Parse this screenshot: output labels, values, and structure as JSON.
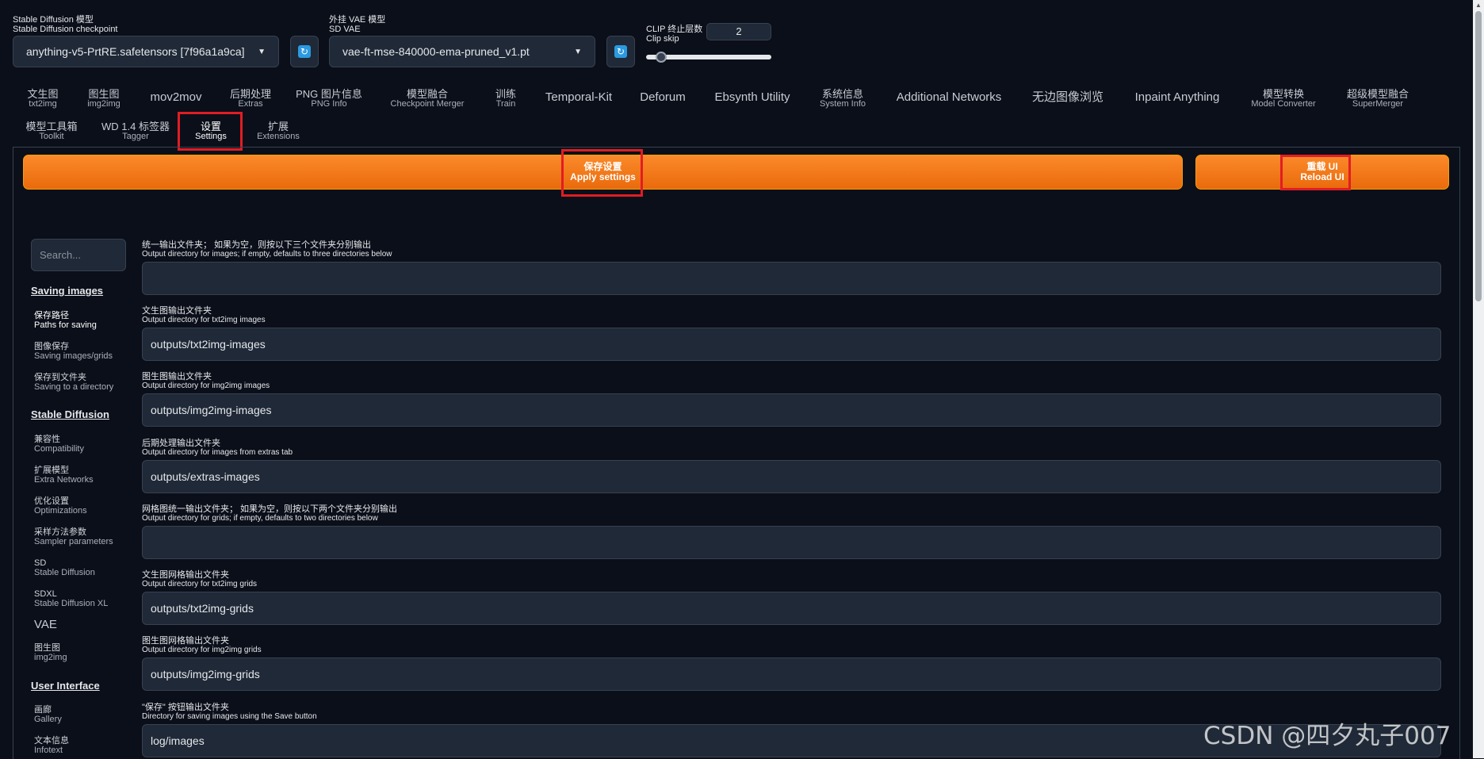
{
  "top": {
    "checkpoint": {
      "label_cn": "Stable Diffusion 模型",
      "label_en": "Stable Diffusion checkpoint",
      "value": "anything-v5-PrtRE.safetensors [7f96a1a9ca]"
    },
    "vae": {
      "label_cn": "外挂 VAE 模型",
      "label_en": "SD VAE",
      "value": "vae-ft-mse-840000-ema-pruned_v1.pt"
    },
    "clip": {
      "label_cn": "CLIP 终止层数",
      "label_en": "Clip skip",
      "value": "2",
      "slider_fraction": 0.08
    },
    "refresh_icon": "refresh-icon",
    "caret_icon": "chevron-down-icon"
  },
  "tabs_row1": [
    {
      "l1": "文生图",
      "l2": "txt2img"
    },
    {
      "l1": "图生图",
      "l2": "img2img"
    },
    {
      "single": "mov2mov"
    },
    {
      "l1": "后期处理",
      "l2": "Extras"
    },
    {
      "l1": "PNG 图片信息",
      "l2": "PNG Info"
    },
    {
      "l1": "模型融合",
      "l2": "Checkpoint Merger"
    },
    {
      "l1": "训练",
      "l2": "Train"
    },
    {
      "single": "Temporal-Kit"
    },
    {
      "single": "Deforum"
    },
    {
      "single": "Ebsynth Utility"
    },
    {
      "l1": "系统信息",
      "l2": "System Info"
    },
    {
      "single": "Additional Networks"
    },
    {
      "single": "无边图像浏览"
    },
    {
      "single": "Inpaint Anything"
    },
    {
      "l1": "模型转换",
      "l2": "Model Converter"
    },
    {
      "l1": "超级模型融合",
      "l2": "SuperMerger"
    }
  ],
  "tabs_row2": [
    {
      "l1": "模型工具箱",
      "l2": "Toolkit"
    },
    {
      "l1": "WD 1.4 标签器",
      "l2": "Tagger"
    },
    {
      "l1": "设置",
      "l2": "Settings"
    },
    {
      "l1": "扩展",
      "l2": "Extensions"
    }
  ],
  "buttons": {
    "apply_cn": "保存设置",
    "apply_en": "Apply settings",
    "reload_cn": "重载 UI",
    "reload_en": "Reload UI"
  },
  "search": {
    "placeholder": "Search..."
  },
  "sidebar": {
    "head_saving": "Saving images",
    "head_sd": "Stable Diffusion",
    "head_ui": "User Interface",
    "vae": "VAE",
    "items": [
      {
        "l1": "保存路径",
        "l2": "Paths for saving"
      },
      {
        "l1": "图像保存",
        "l2": "Saving images/grids"
      },
      {
        "l1": "保存到文件夹",
        "l2": "Saving to a directory"
      },
      {
        "l1": "兼容性",
        "l2": "Compatibility"
      },
      {
        "l1": "扩展模型",
        "l2": "Extra Networks"
      },
      {
        "l1": "优化设置",
        "l2": "Optimizations"
      },
      {
        "l1": "采样方法参数",
        "l2": "Sampler parameters"
      },
      {
        "l1": "SD",
        "l2": "Stable Diffusion"
      },
      {
        "l1": "SDXL",
        "l2": "Stable Diffusion XL"
      },
      {
        "l1": "图生图",
        "l2": "img2img"
      },
      {
        "l1": "画廊",
        "l2": "Gallery"
      },
      {
        "l1": "文本信息",
        "l2": "Infotext"
      }
    ]
  },
  "fields": [
    {
      "l1": "统一输出文件夹； 如果为空，则按以下三个文件夹分别输出",
      "l2": "Output directory for images; if empty, defaults to three directories below",
      "value": ""
    },
    {
      "l1": "文生图输出文件夹",
      "l2": "Output directory for txt2img images",
      "value": "outputs/txt2img-images"
    },
    {
      "l1": "图生图输出文件夹",
      "l2": "Output directory for img2img images",
      "value": "outputs/img2img-images"
    },
    {
      "l1": "后期处理输出文件夹",
      "l2": "Output directory for images from extras tab",
      "value": "outputs/extras-images"
    },
    {
      "l1": "网格图统一输出文件夹； 如果为空，则按以下两个文件夹分别输出",
      "l2": "Output directory for grids; if empty, defaults to two directories below",
      "value": ""
    },
    {
      "l1": "文生图网格输出文件夹",
      "l2": "Output directory for txt2img grids",
      "value": "outputs/txt2img-grids"
    },
    {
      "l1": "图生图网格输出文件夹",
      "l2": "Output directory for img2img grids",
      "value": "outputs/img2img-grids"
    },
    {
      "l1": "\"保存\" 按钮输出文件夹",
      "l2": "Directory for saving images using the Save button",
      "value": "log/images"
    }
  ],
  "watermark": "CSDN @四夕丸子007",
  "colors": {
    "accent": "#f97316",
    "highlight_box": "#e11d24",
    "background": "#0b0f19"
  }
}
